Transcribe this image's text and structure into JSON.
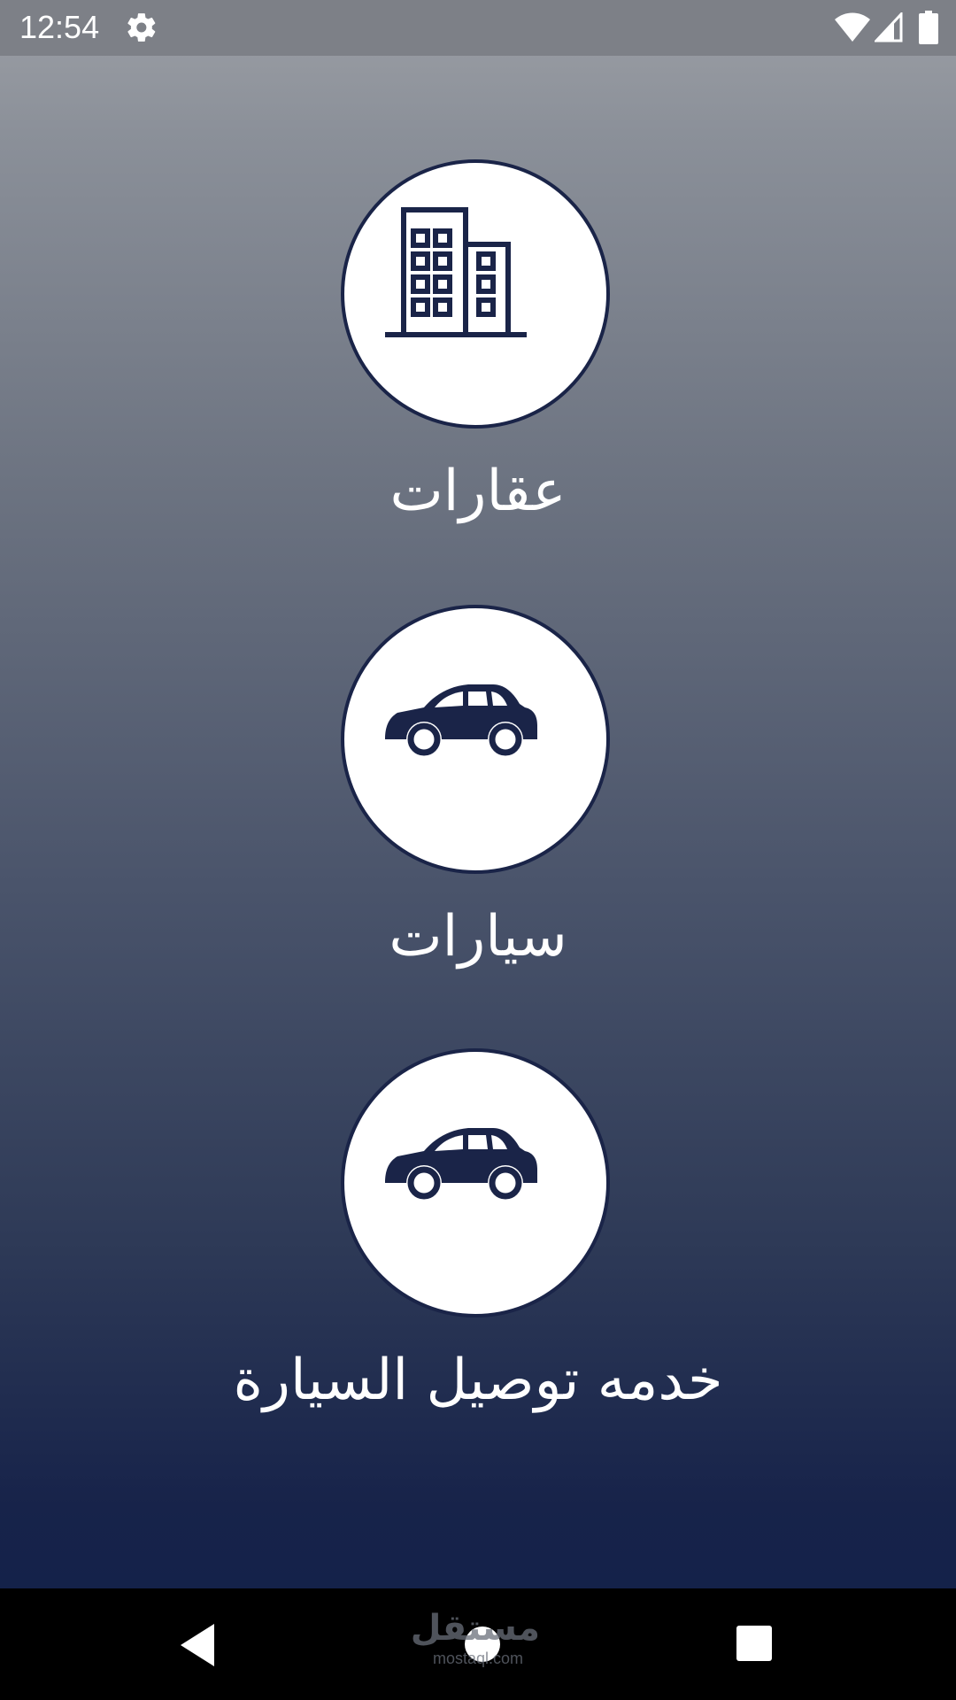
{
  "status_bar": {
    "time": "12:54",
    "icons": [
      "settings-icon",
      "wifi-icon",
      "signal-icon",
      "battery-icon"
    ]
  },
  "menu": {
    "items": [
      {
        "label": "عقارات",
        "icon": "building-icon"
      },
      {
        "label": "سيارات",
        "icon": "car-icon"
      },
      {
        "label": "خدمه توصيل السيارة",
        "icon": "car-icon"
      }
    ]
  },
  "nav_bar": {
    "watermark_ar": "مستقل",
    "watermark_en": "mostaql.com",
    "buttons": [
      "back-icon",
      "home-icon",
      "recents-icon"
    ]
  },
  "colors": {
    "status_bar": "#7d8087",
    "gradient_top": "#9c9fa5",
    "gradient_bottom": "#14224a",
    "icon_navy": "#1a2448",
    "circle_fill": "#ffffff",
    "label_text": "#ffffff"
  }
}
